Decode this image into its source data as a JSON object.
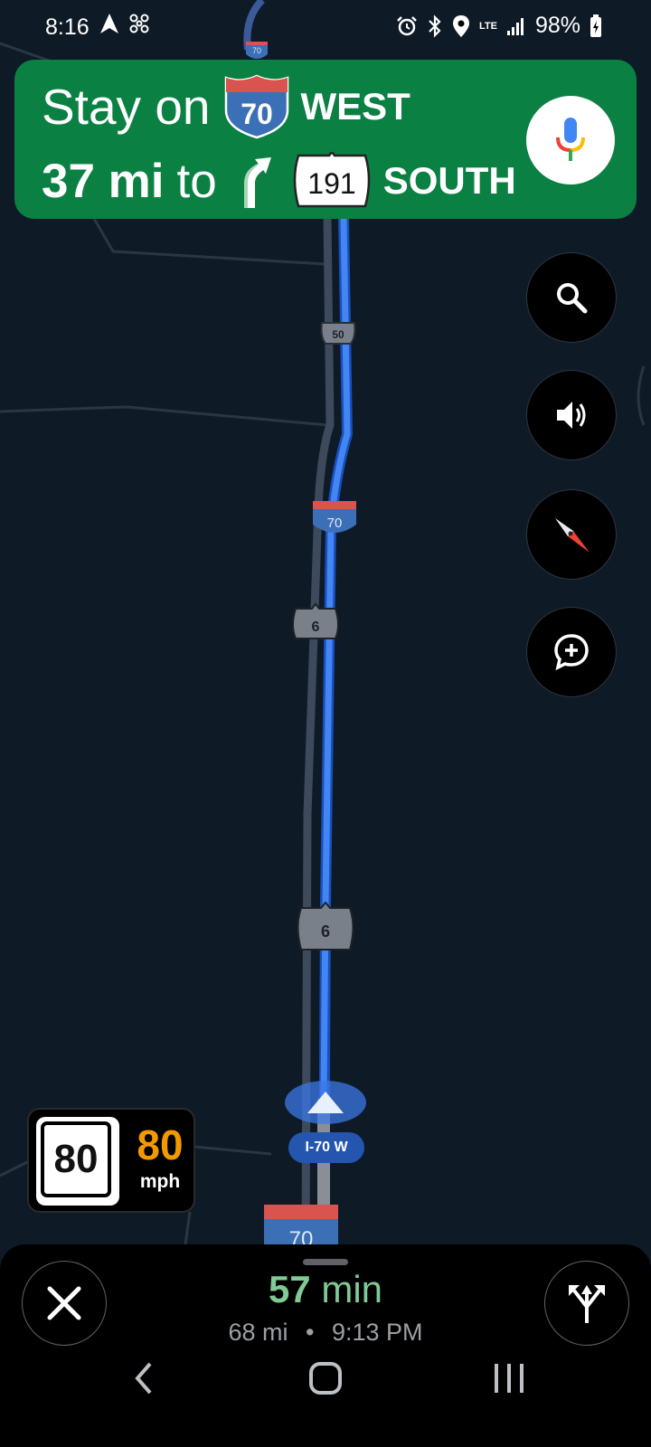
{
  "status_bar": {
    "time": "8:16",
    "battery": "98%",
    "network": "LTE"
  },
  "banner": {
    "line1_prefix": "Stay on",
    "line1_shield": "70",
    "line1_direction": "WEST",
    "line2_distance": "37 mi",
    "line2_to": "to",
    "line2_shield": "191",
    "line2_direction": "SOUTH",
    "color": "#0b8043"
  },
  "map": {
    "shields": {
      "top_70": "70",
      "us_50": "50",
      "i70_mid": "70",
      "us_6_a": "6",
      "us_6_b": "6",
      "i70_bottom": "70"
    },
    "current_road_label": "I-70 W",
    "route_color": "#4285f4"
  },
  "speed": {
    "limit": "80",
    "current": "80",
    "unit": "mph",
    "current_color": "#f29900"
  },
  "trip": {
    "duration_value": "57",
    "duration_unit": "min",
    "distance": "68 mi",
    "separator": "•",
    "arrival": "9:13 PM"
  },
  "icons": {
    "mic": "mic-icon",
    "search": "search-icon",
    "volume": "volume-icon",
    "compass": "compass-icon",
    "report": "add-report-icon",
    "close": "close-icon",
    "routes": "alternate-routes-icon"
  }
}
